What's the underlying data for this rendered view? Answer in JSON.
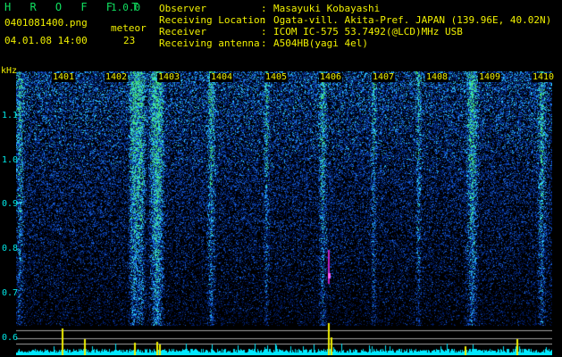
{
  "header": {
    "app_title": "H R O F F T",
    "version": "1.0.0",
    "file_name": "0401081400.png",
    "date_time": "04.01.08 14:00",
    "meteor_label": "meteor",
    "meteor_count": "23"
  },
  "info": [
    {
      "key": "Observer",
      "value": "Masayuki Kobayashi"
    },
    {
      "key": "Receiving Location",
      "value": "Ogata-vill. Akita-Pref. JAPAN (139.96E, 40.02N)"
    },
    {
      "key": "Receiver",
      "value": "ICOM IC-575 53.7492(@LCD)MHz USB"
    },
    {
      "key": "Receiving antenna",
      "value": "A504HB(yagi 4el)"
    }
  ],
  "axis": {
    "y_unit": "kHz",
    "y_ticks": [
      "1.1",
      "1.0",
      "0.9",
      "0.8",
      "0.7",
      "0.6"
    ],
    "x_ticks": [
      "1401",
      "1402",
      "1403",
      "1404",
      "1405",
      "1406",
      "1407",
      "1408",
      "1409",
      "1410"
    ]
  },
  "colors": {
    "background": "#000000",
    "noise_low": "#001a66",
    "noise_mid": "#1a5fd6",
    "noise_high": "#2fd2ff",
    "meteor_trace": "#c020c0",
    "signal_bars": "#f0f000",
    "baseline": "#00e8ff",
    "label_yellow": "#f0f000",
    "label_cyan": "#00e8e8",
    "title_green": "#10e060"
  }
}
